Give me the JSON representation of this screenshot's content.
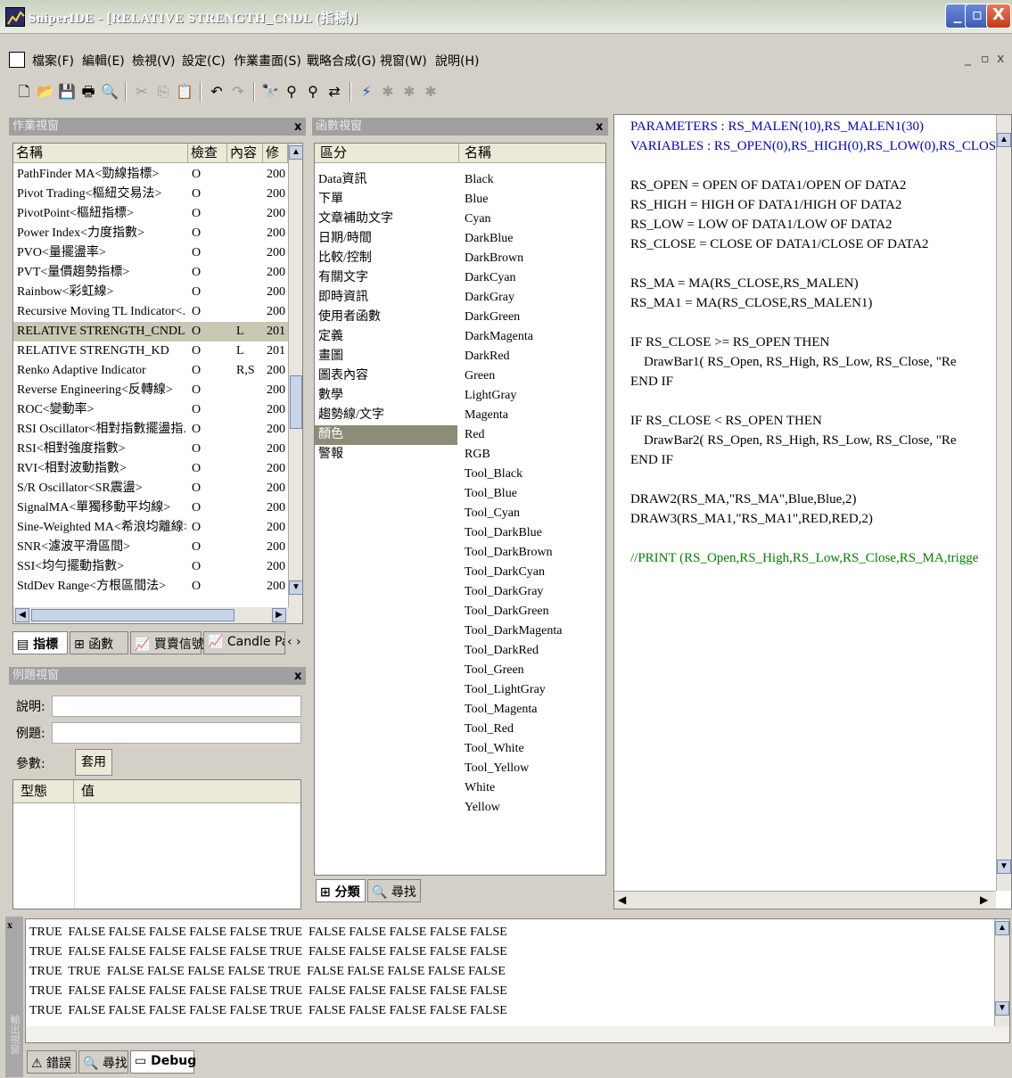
{
  "window": {
    "title": "SniperIDE - [RELATIVE STRENGTH_CNDL (指標)]"
  },
  "menu": [
    "檔案(F)",
    "編輯(E)",
    "檢視(V)",
    "設定(C)",
    "作業畫面(S)",
    "戰略合成(G)",
    "視窗(W)",
    "說明(H)"
  ],
  "workpane": {
    "title": "作業視窗",
    "headers": [
      "名稱",
      "檢查",
      "內容",
      "修"
    ],
    "rows": [
      [
        "PathFinder MA<勁線指標>",
        "O",
        "",
        "200"
      ],
      [
        "Pivot Trading<樞紐交易法>",
        "O",
        "",
        "200"
      ],
      [
        "PivotPoint<樞紐指標>",
        "O",
        "",
        "200"
      ],
      [
        "Power Index<力度指數>",
        "O",
        "",
        "200"
      ],
      [
        "PVO<量擺盪率>",
        "O",
        "",
        "200"
      ],
      [
        "PVT<量價趨勢指標>",
        "O",
        "",
        "200"
      ],
      [
        "Rainbow<彩虹線>",
        "O",
        "",
        "200"
      ],
      [
        "Recursive Moving TL Indicator<...",
        "O",
        "",
        "200"
      ],
      [
        "RELATIVE STRENGTH_CNDL",
        "O",
        "L",
        "201"
      ],
      [
        "RELATIVE STRENGTH_KD",
        "O",
        "L",
        "201"
      ],
      [
        "Renko Adaptive Indicator",
        "O",
        "R,S",
        "200"
      ],
      [
        "Reverse Engineering<反轉線>",
        "O",
        "",
        "200"
      ],
      [
        "ROC<變動率>",
        "O",
        "",
        "200"
      ],
      [
        "RSI Oscillator<相對指數擺盪指...",
        "O",
        "",
        "200"
      ],
      [
        "RSI<相對強度指數>",
        "O",
        "",
        "200"
      ],
      [
        "RVI<相對波動指數>",
        "O",
        "",
        "200"
      ],
      [
        "S/R Oscillator<SR震盪>",
        "O",
        "",
        "200"
      ],
      [
        "SignalMA<單獨移動平均線>",
        "O",
        "",
        "200"
      ],
      [
        "Sine-Weighted MA<希浪均離線>",
        "O",
        "",
        "200"
      ],
      [
        "SNR<濾波平滑區間>",
        "O",
        "",
        "200"
      ],
      [
        "SSI<均勻擺動指數>",
        "O",
        "",
        "200"
      ],
      [
        "StdDev Range<方根區間法>",
        "O",
        "",
        "200"
      ]
    ],
    "tabs": [
      "指標",
      "函數",
      "買賣信號",
      "Candle Patt"
    ]
  },
  "examplepane": {
    "title": "例題視窗",
    "desc_label": "說明:",
    "example_label": "例題:",
    "param_label": "參數:",
    "apply_button": "套用",
    "col_type": "型態",
    "col_value": "值"
  },
  "funcpane": {
    "title": "函數視窗",
    "headers": [
      "區分",
      "名稱"
    ],
    "categories": [
      "Data資訊",
      "下單",
      "文章補助文字",
      "日期/時間",
      "比較/控制",
      "有關文字",
      "即時資訊",
      "使用者函數",
      "定義",
      "畫圖",
      "圖表內容",
      "數學",
      "趨勢線/文字",
      "顏色",
      "警報"
    ],
    "names": [
      "Black",
      "Blue",
      "Cyan",
      "DarkBlue",
      "DarkBrown",
      "DarkCyan",
      "DarkGray",
      "DarkGreen",
      "DarkMagenta",
      "DarkRed",
      "Green",
      "LightGray",
      "Magenta",
      "Red",
      "RGB",
      "Tool_Black",
      "Tool_Blue",
      "Tool_Cyan",
      "Tool_DarkBlue",
      "Tool_DarkBrown",
      "Tool_DarkCyan",
      "Tool_DarkGray",
      "Tool_DarkGreen",
      "Tool_DarkMagenta",
      "Tool_DarkRed",
      "Tool_Green",
      "Tool_LightGray",
      "Tool_Magenta",
      "Tool_Red",
      "Tool_White",
      "Tool_Yellow",
      "White",
      "Yellow"
    ],
    "tabs": [
      "分類",
      "尋找"
    ]
  },
  "code": [
    "PARAMETERS : RS_MALEN(10),RS_MALEN1(30)",
    "VARIABLES : RS_OPEN(0),RS_HIGH(0),RS_LOW(0),RS_CLOSE(",
    "",
    "RS_OPEN = OPEN OF DATA1/OPEN OF DATA2",
    "RS_HIGH = HIGH OF DATA1/HIGH OF DATA2",
    "RS_LOW = LOW OF DATA1/LOW OF DATA2",
    "RS_CLOSE = CLOSE OF DATA1/CLOSE OF DATA2",
    "",
    "RS_MA = MA(RS_CLOSE,RS_MALEN)",
    "RS_MA1 = MA(RS_CLOSE,RS_MALEN1)",
    "",
    "IF RS_CLOSE >= RS_OPEN THEN",
    "    DrawBar1( RS_Open, RS_High, RS_Low, RS_Close, \"Re",
    "END IF",
    "",
    "IF RS_CLOSE < RS_OPEN THEN",
    "    DrawBar2( RS_Open, RS_High, RS_Low, RS_Close, \"Re",
    "END IF",
    "",
    "DRAW2(RS_MA,\"RS_MA\",Blue,Blue,2)",
    "DRAW3(RS_MA1,\"RS_MA1\",RED,RED,2)",
    "",
    "//PRINT (RS_Open,RS_High,RS_Low,RS_Close,RS_MA,trigge"
  ],
  "output": {
    "side_title": "輸出視窗",
    "lines": [
      "TRUE  FALSE FALSE FALSE FALSE FALSE TRUE  FALSE FALSE FALSE FALSE FALSE",
      "TRUE  FALSE FALSE FALSE FALSE FALSE TRUE  FALSE FALSE FALSE FALSE FALSE",
      "TRUE  TRUE  FALSE FALSE FALSE FALSE TRUE  FALSE FALSE FALSE FALSE FALSE",
      "TRUE  FALSE FALSE FALSE FALSE FALSE TRUE  FALSE FALSE FALSE FALSE FALSE",
      "TRUE  FALSE FALSE FALSE FALSE FALSE TRUE  FALSE FALSE FALSE FALSE FALSE"
    ],
    "tabs": [
      "錯誤",
      "尋找",
      "Debug"
    ]
  },
  "colors": {
    "selection": "#c8c8b4",
    "code_keyword": "#0000cc",
    "code_string": "#cc0000",
    "code_comment": "#008000"
  }
}
